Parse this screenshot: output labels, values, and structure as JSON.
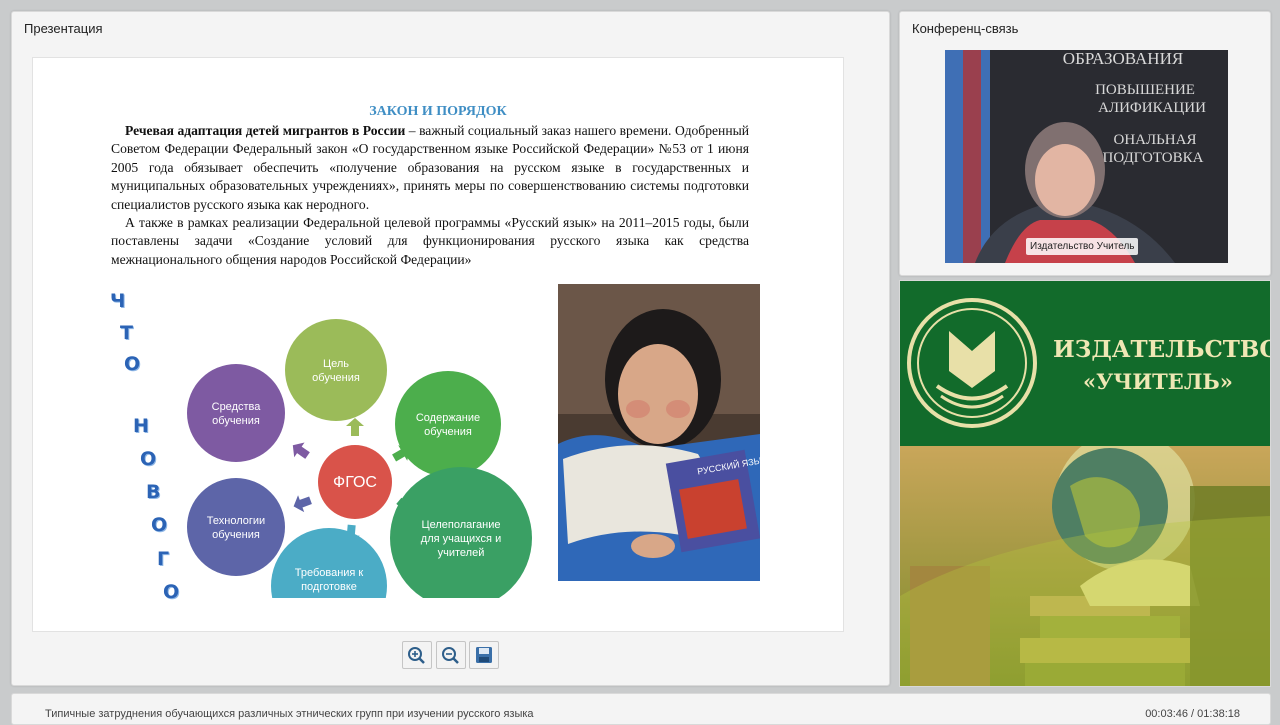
{
  "presentation": {
    "panel_title": "Презентация",
    "slide": {
      "heading": "ЗАКОН И ПОРЯДОК",
      "para1_bold": "Речевая адаптация детей мигрантов в России",
      "para1_rest": " – важный социальный заказ нашего времени. Одобренный Советом Федерации Федеральный закон «О государственном языке Российской Федерации» №53 от 1 июня 2005 года обязывает обеспечить «получение образования на русском языке в государственных и муниципальных образовательных учреждениях», принять меры по совершенствованию системы подготовки специалистов русского языка как неродного.",
      "para2": "А также в рамках реализации Федеральной целевой программы «Русский язык» на 2011–2015 годы, были поставлены задачи «Создание условий для функционирования русского языка как средства межнационального общения народов Российской Федерации»",
      "vertical_word1": [
        "Ч",
        "Т",
        "О"
      ],
      "vertical_word2": [
        "Н",
        "О",
        "В",
        "О",
        "Г",
        "О"
      ],
      "center_label": "ФГОС",
      "circles": [
        {
          "label": "Цель обучения",
          "color": "#9bbb59"
        },
        {
          "label": "Содержание обучения",
          "color": "#4cae4c"
        },
        {
          "label": "Целеполагание для учащихся и учителей",
          "color": "#3aa064"
        },
        {
          "label": "Требования к подготовке учителя",
          "color": "#4bacc6"
        },
        {
          "label": "Технологии обучения",
          "color": "#5d65a8"
        },
        {
          "label": "Средства обучения",
          "color": "#7e5aa2"
        }
      ],
      "photo_book_text": "РУССКИЙ ЯЗЫК"
    },
    "toolbar": {
      "zoom_in_icon": "zoom-in-icon",
      "zoom_out_icon": "zoom-out-icon",
      "save_icon": "save-icon"
    }
  },
  "conference": {
    "panel_title": "Конференц-связь",
    "video_label": "Издательство Учитель",
    "background_texts": [
      "ОБРАЗОВАНИЯ",
      "ПОВЫШЕНИЕ",
      "АЛИФИКАЦИИ",
      "ОНАЛЬНАЯ",
      "ПОДГОТОВКА"
    ]
  },
  "ad": {
    "line1": "ИЗДАТЕЛЬСТВО",
    "line2": "«УЧИТЕЛЬ»"
  },
  "footer": {
    "lecture_title": "Типичные затруднения обучающихся различных этнических групп при изучении русского языка",
    "time": "00:03:46 / 01:38:18"
  }
}
